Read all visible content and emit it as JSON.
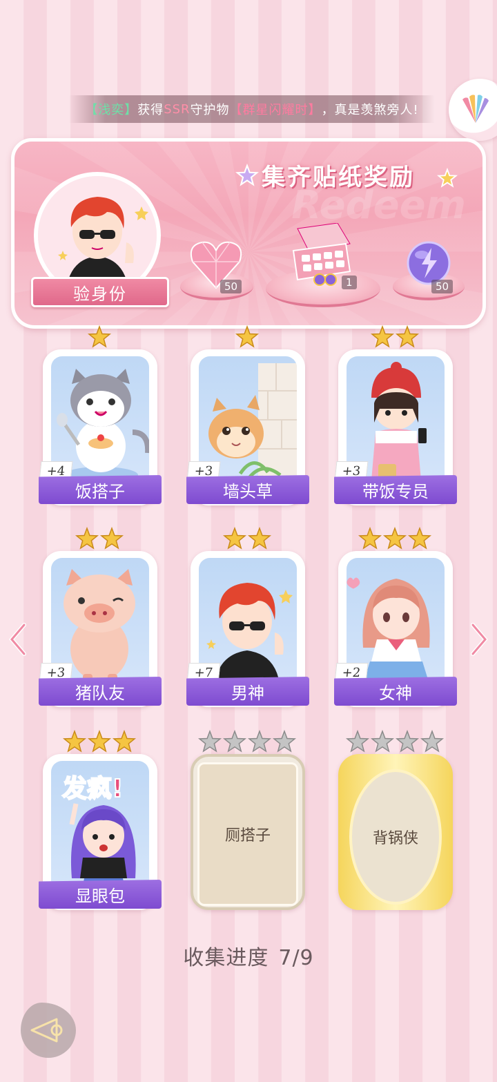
{
  "marquee": {
    "prefix": "【",
    "name": "浅奕",
    "mid1": "】获得",
    "ssr": "SSR",
    "mid2": "守护物",
    "item": "【群星闪耀时】",
    "suffix": "，真是羡煞旁人!"
  },
  "reward": {
    "title": "集齐贴纸奖励",
    "verify_label": "验身份",
    "items": [
      {
        "icon": "pink-heart-gem-icon",
        "qty": "50"
      },
      {
        "icon": "gift-box-icon",
        "qty": "1"
      },
      {
        "icon": "lightning-orb-icon",
        "qty": "50"
      }
    ]
  },
  "cards": [
    {
      "name": "饭搭子",
      "plus": "+4",
      "stars": 1,
      "locked": false
    },
    {
      "name": "墙头草",
      "plus": "+3",
      "stars": 1,
      "locked": false
    },
    {
      "name": "带饭专员",
      "plus": "+3",
      "stars": 2,
      "locked": false
    },
    {
      "name": "猪队友",
      "plus": "+3",
      "stars": 2,
      "locked": false
    },
    {
      "name": "男神",
      "plus": "+7",
      "stars": 2,
      "locked": false
    },
    {
      "name": "女神",
      "plus": "+2",
      "stars": 3,
      "locked": false
    },
    {
      "name": "显眼包",
      "plus": "",
      "stars": 3,
      "locked": false,
      "art_text": "发疯!"
    },
    {
      "name": "厕搭子",
      "stars": 4,
      "locked": true
    },
    {
      "name": "背锅侠",
      "stars": 4,
      "locked": true
    }
  ],
  "progress": {
    "label": "收集进度",
    "value": "7/9"
  },
  "colors": {
    "label_purple": "#8a57d8",
    "pink": "#f4a7b8",
    "gold_star": "#f5c542",
    "grey_star": "#b8b8b8"
  }
}
